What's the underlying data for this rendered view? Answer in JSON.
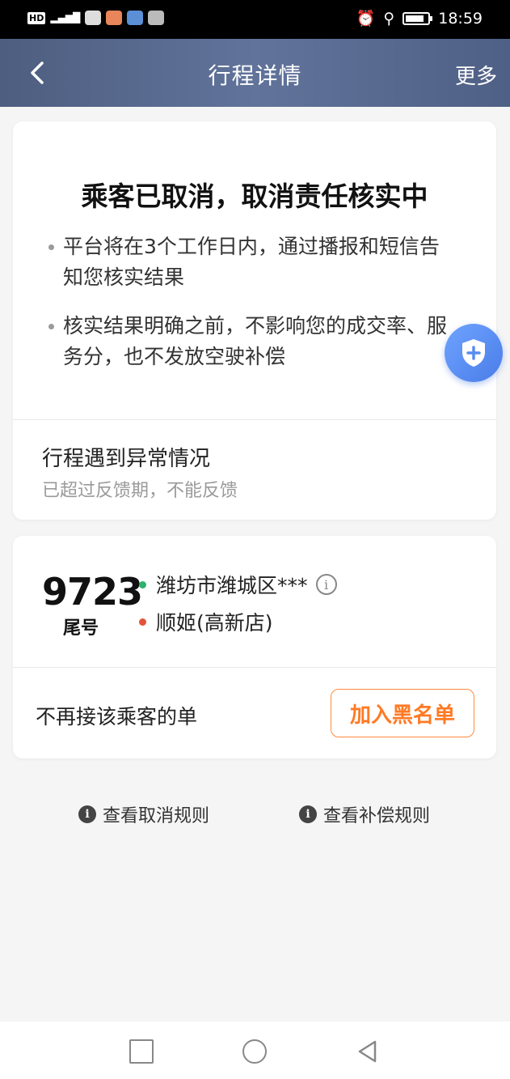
{
  "status_bar": {
    "hd": "HD",
    "network": "4G",
    "time": "18:59"
  },
  "navbar": {
    "title": "行程详情",
    "more": "更多"
  },
  "status_card": {
    "heading": "乘客已取消，取消责任核实中",
    "bullets": [
      "平台将在3个工作日内，通过播报和短信告知您核实结果",
      "核实结果明确之前，不影响您的成交率、服务分，也不发放空驶补偿"
    ],
    "abnormal_title": "行程遇到异常情况",
    "abnormal_sub": "已超过反馈期，不能反馈"
  },
  "trip_card": {
    "tail_number": "9723",
    "tail_label": "尾号",
    "origin": "潍坊市潍城区***",
    "destination": "顺姬(高新店)",
    "block_text": "不再接该乘客的单",
    "block_button": "加入黑名单"
  },
  "rules": {
    "cancel_rules": "查看取消规则",
    "compensation_rules": "查看补偿规则"
  },
  "colors": {
    "origin_dot": "#2db36b",
    "destination_dot": "#e2533a",
    "accent_orange": "#ff7a24",
    "shield_blue": "#4a7de8"
  }
}
